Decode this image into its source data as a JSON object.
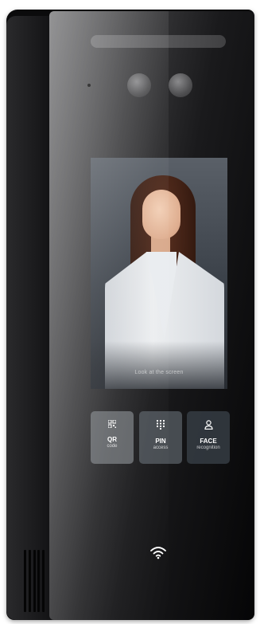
{
  "screen": {
    "prompt_text": "Look at the screen"
  },
  "access_buttons": [
    {
      "title": "QR",
      "subtitle": "code",
      "icon": "qr-code-icon"
    },
    {
      "title": "PIN",
      "subtitle": "access",
      "icon": "keypad-icon"
    },
    {
      "title": "FACE",
      "subtitle": "recognition",
      "icon": "person-icon"
    }
  ],
  "status_icon": "wifi-icon",
  "colors": {
    "device_body": "#0b0b0c",
    "button_qr": "#787c80",
    "button_pin": "#50565c",
    "button_face": "#32383e"
  }
}
